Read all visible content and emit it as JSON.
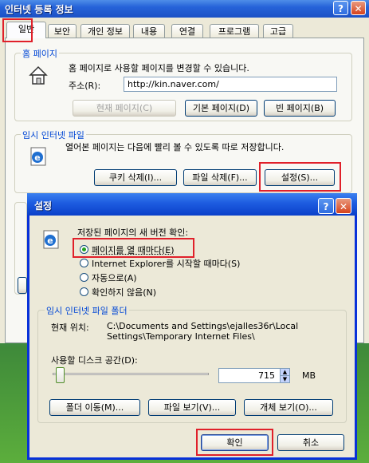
{
  "main_window": {
    "title": "인터넷 등록 정보",
    "tabs": [
      "일반",
      "보안",
      "개인 정보",
      "내용",
      "연결",
      "프로그램",
      "고급"
    ],
    "home": {
      "group_label": "홈 페이지",
      "description": "홈 페이지로 사용할 페이지를 변경할 수 있습니다.",
      "address_label": "주소(R):",
      "address_value": "http://kin.naver.com/",
      "btn_current": "현재 페이지(C)",
      "btn_default": "기본 페이지(D)",
      "btn_blank": "빈 페이지(B)"
    },
    "temp": {
      "group_label": "임시 인터넷 파일",
      "description": "열어본 페이지는 다음에 빨리 볼 수 있도록 따로 저장합니다.",
      "btn_cookies": "쿠키 삭제(I)...",
      "btn_files": "파일 삭제(F)...",
      "btn_settings": "설정(S)..."
    }
  },
  "dialog": {
    "title": "설정",
    "check_label": "저장된 페이지의 새 버전 확인:",
    "options": [
      "페이지를 열 때마다(E)",
      "Internet Explorer를 시작할 때마다(S)",
      "자동으로(A)",
      "확인하지 않음(N)"
    ],
    "selected_option": 0,
    "folder_group_label": "임시 인터넷 파일 폴더",
    "location_label": "현재 위치:",
    "location_line1": "C:\\Documents and Settings\\ejalles36r\\Local",
    "location_line2": "Settings\\Temporary Internet Files\\",
    "disk_label": "사용할 디스크 공간(D):",
    "disk_value": "715",
    "disk_unit": "MB",
    "slider_fraction": 0.02,
    "btn_move": "폴더 이동(M)...",
    "btn_view_files": "파일 보기(V)...",
    "btn_view_objects": "개체 보기(O)...",
    "btn_ok": "확인",
    "btn_cancel": "취소"
  },
  "colors": {
    "highlight_red": "#e0202a",
    "title_blue": "#0831d9"
  }
}
